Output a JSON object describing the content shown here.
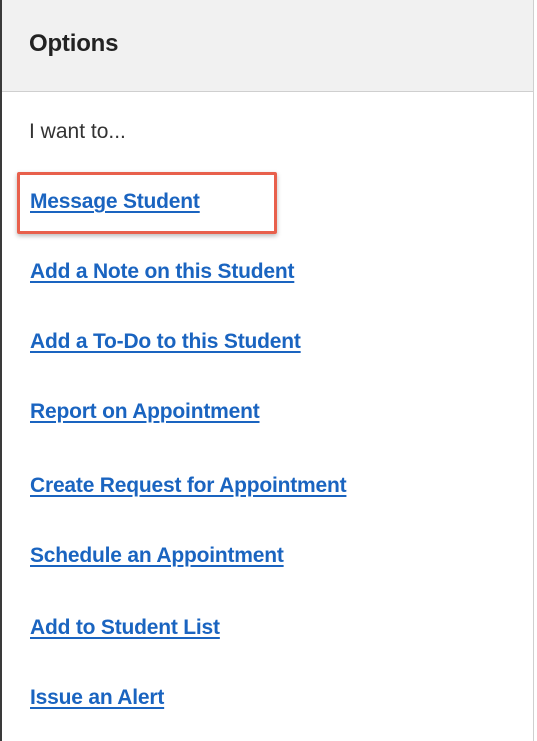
{
  "panel": {
    "title": "Options",
    "intro": "I want to..."
  },
  "options": [
    {
      "label": "Message Student",
      "highlighted": true
    },
    {
      "label": "Add a Note on this Student",
      "highlighted": false
    },
    {
      "label": "Add a To-Do to this Student",
      "highlighted": false
    },
    {
      "label": "Report on Appointment",
      "highlighted": false
    },
    {
      "label": "Create Request for Appointment",
      "highlighted": false
    },
    {
      "label": "Schedule an Appointment",
      "highlighted": false
    },
    {
      "label": "Add to Student List",
      "highlighted": false
    },
    {
      "label": "Issue an Alert",
      "highlighted": false
    }
  ],
  "colors": {
    "link": "#1a64c0",
    "highlight_border": "#e8604c",
    "header_background": "#f1f1f1"
  }
}
